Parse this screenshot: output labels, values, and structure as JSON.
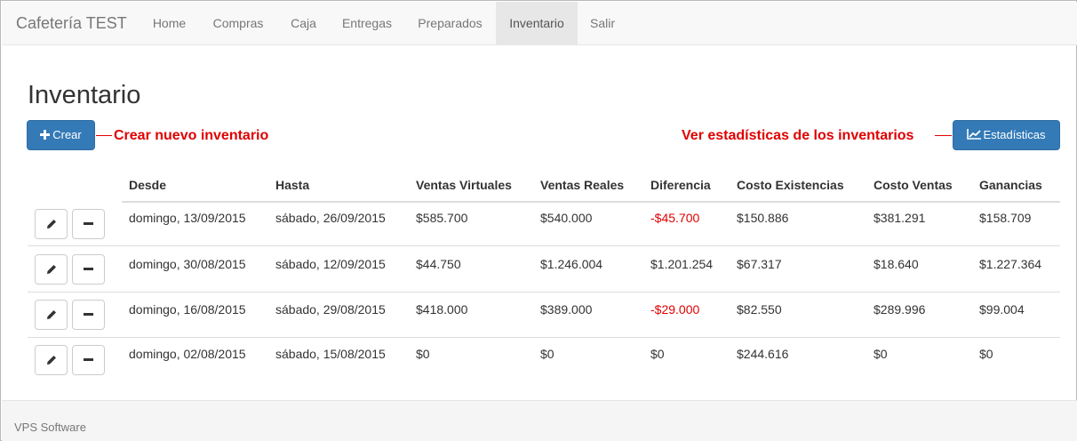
{
  "navbar": {
    "brand": "Cafetería TEST",
    "items": [
      {
        "label": "Home",
        "active": false
      },
      {
        "label": "Compras",
        "active": false
      },
      {
        "label": "Caja",
        "active": false
      },
      {
        "label": "Entregas",
        "active": false
      },
      {
        "label": "Preparados",
        "active": false
      },
      {
        "label": "Inventario",
        "active": true
      },
      {
        "label": "Salir",
        "active": false
      }
    ]
  },
  "page": {
    "title": "Inventario",
    "create_button": {
      "label": "Crear",
      "icon": "plus-icon"
    },
    "create_annotation": "Crear nuevo inventario",
    "stats_button": {
      "label": "Estadísticas",
      "icon": "line-chart-icon"
    },
    "stats_annotation": "Ver estadísticas de los inventarios",
    "accent_color": "#337ab7",
    "annotation_color": "#e00000",
    "negative_color": "#e00000"
  },
  "table": {
    "columns": [
      "Desde",
      "Hasta",
      "Ventas Virtuales",
      "Ventas Reales",
      "Diferencia",
      "Costo Existencias",
      "Costo Ventas",
      "Ganancias"
    ],
    "rows": [
      {
        "desde": "domingo, 13/09/2015",
        "hasta": "sábado, 26/09/2015",
        "ventas_virtuales": "$585.700",
        "ventas_reales": "$540.000",
        "diferencia": "-$45.700",
        "diferencia_negative": true,
        "costo_existencias": "$150.886",
        "costo_ventas": "$381.291",
        "ganancias": "$158.709"
      },
      {
        "desde": "domingo, 30/08/2015",
        "hasta": "sábado, 12/09/2015",
        "ventas_virtuales": "$44.750",
        "ventas_reales": "$1.246.004",
        "diferencia": "$1.201.254",
        "diferencia_negative": false,
        "costo_existencias": "$67.317",
        "costo_ventas": "$18.640",
        "ganancias": "$1.227.364"
      },
      {
        "desde": "domingo, 16/08/2015",
        "hasta": "sábado, 29/08/2015",
        "ventas_virtuales": "$418.000",
        "ventas_reales": "$389.000",
        "diferencia": "-$29.000",
        "diferencia_negative": true,
        "costo_existencias": "$82.550",
        "costo_ventas": "$289.996",
        "ganancias": "$99.004"
      },
      {
        "desde": "domingo, 02/08/2015",
        "hasta": "sábado, 15/08/2015",
        "ventas_virtuales": "$0",
        "ventas_reales": "$0",
        "diferencia": "$0",
        "diferencia_negative": false,
        "costo_existencias": "$244.616",
        "costo_ventas": "$0",
        "ganancias": "$0"
      }
    ],
    "row_actions": [
      {
        "name": "edit",
        "icon": "pencil-icon"
      },
      {
        "name": "delete",
        "icon": "minus-icon"
      }
    ]
  },
  "footer": {
    "text": "VPS Software"
  }
}
